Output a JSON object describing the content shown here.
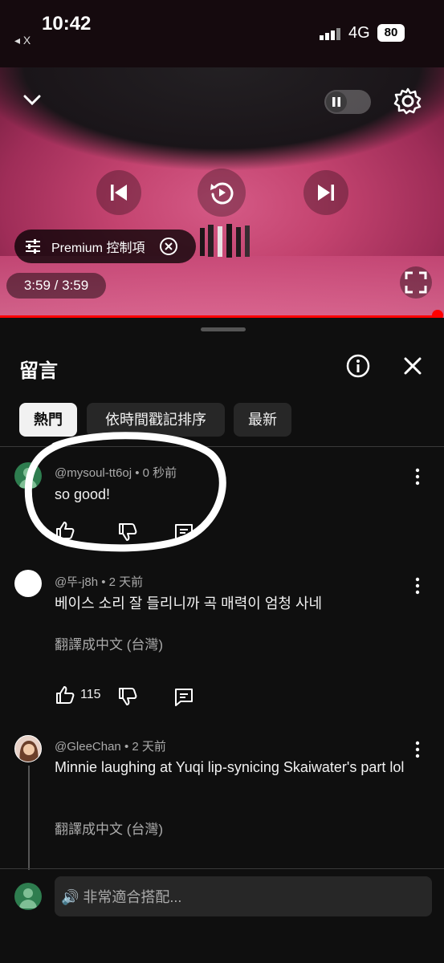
{
  "status_bar": {
    "time": "10:42",
    "back_app": "◂ X",
    "network": "4G",
    "battery": "80"
  },
  "player": {
    "premium_label": "Premium 控制項",
    "time": "3:59 / 3:59",
    "progress_fraction": 1.0,
    "accent_color": "#ff0000"
  },
  "comments": {
    "title": "留言",
    "filters": [
      "熱門",
      "依時間戳記排序",
      "最新"
    ],
    "items": [
      {
        "author_meta": "@mysoul-tt6oj • 0 秒前",
        "text": "so good!",
        "likes": "",
        "translate": ""
      },
      {
        "author_meta": "@뚜-j8h • 2 天前",
        "text": "베이스 소리 잘 들리니까 곡 매력이 엄청 사네",
        "likes": "115",
        "translate": "翻譯成中文 (台灣)"
      },
      {
        "author_meta": "@GleeChan • 2 天前",
        "text": "Minnie laughing at Yuqi lip-synicing Skaiwater's part lol",
        "likes": "",
        "translate": "翻譯成中文 (台灣)"
      }
    ],
    "input_placeholder": "🔊 非常適合搭配..."
  },
  "icons": {
    "collapse": "chevron-down-icon",
    "settings": "gear-icon",
    "previous": "skip-previous-icon",
    "replay": "replay-icon",
    "next": "skip-next-icon",
    "fullscreen": "fullscreen-icon",
    "info": "info-icon",
    "close": "close-icon",
    "like": "thumb-up-icon",
    "dislike": "thumb-down-icon",
    "reply": "reply-icon",
    "more": "more-vert-icon"
  }
}
